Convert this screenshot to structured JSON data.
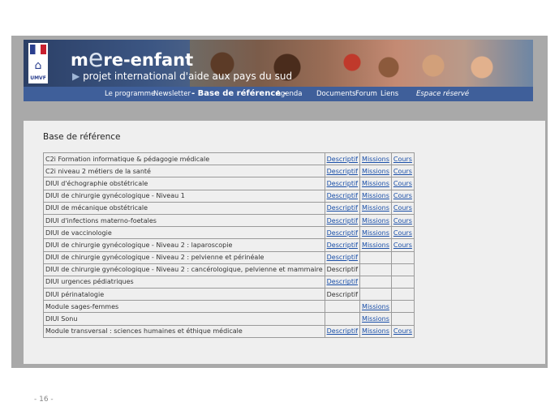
{
  "header": {
    "brand_prefix": "m",
    "brand_e": "e",
    "brand_suffix": "re-enfant",
    "tagline_arrow": "▶",
    "tagline": "projet international d'aide aux pays du sud",
    "logo_text": "UMVF"
  },
  "nav": {
    "items": [
      "Le programme",
      "Newsletter",
      "- Base de référence -",
      "Agenda",
      "Documents",
      "Forum",
      "Liens",
      "Espace réservé"
    ]
  },
  "content": {
    "title": "Base de référence",
    "rows": [
      {
        "name": "C2i Formation informatique & pédagogie médicale",
        "descriptif": "Descriptif",
        "descriptif_link": true,
        "missions": "Missions",
        "cours": "Cours"
      },
      {
        "name": "C2i niveau 2 métiers de la santé",
        "descriptif": "Descriptif",
        "descriptif_link": true,
        "missions": "Missions",
        "cours": "Cours"
      },
      {
        "name": "DIUI d'échographie obstétricale",
        "descriptif": "Descriptif",
        "descriptif_link": true,
        "missions": "Missions",
        "cours": "Cours"
      },
      {
        "name": "DIUI de chirurgie gynécologique - Niveau 1",
        "descriptif": "Descriptif",
        "descriptif_link": true,
        "missions": "Missions",
        "cours": "Cours"
      },
      {
        "name": "DIUI de mécanique obstétricale",
        "descriptif": "Descriptif",
        "descriptif_link": true,
        "missions": "Missions",
        "cours": "Cours"
      },
      {
        "name": "DIUI d'infections materno-foetales",
        "descriptif": "Descriptif",
        "descriptif_link": true,
        "missions": "Missions",
        "cours": "Cours"
      },
      {
        "name": "DIUI de vaccinologie",
        "descriptif": "Descriptif",
        "descriptif_link": true,
        "missions": "Missions",
        "cours": "Cours"
      },
      {
        "name": "DIUI de chirurgie gynécologique - Niveau 2 : laparoscopie",
        "descriptif": "Descriptif",
        "descriptif_link": true,
        "missions": "Missions",
        "cours": "Cours"
      },
      {
        "name": "DIUI de chirurgie gynécologique - Niveau 2 : pelvienne et périnéale",
        "descriptif": "Descriptif",
        "descriptif_link": true,
        "missions": "",
        "cours": ""
      },
      {
        "name": "DIUI de chirurgie gynécologique - Niveau 2 : cancérologique, pelvienne et mammaire",
        "descriptif": "Descriptif",
        "descriptif_link": false,
        "missions": "",
        "cours": ""
      },
      {
        "name": "DIUI urgences pédiatriques",
        "descriptif": "Descriptif",
        "descriptif_link": true,
        "missions": "",
        "cours": ""
      },
      {
        "name": "DIUI périnatalogie",
        "descriptif": "Descriptif",
        "descriptif_link": false,
        "missions": "",
        "cours": ""
      },
      {
        "name": "Module sages-femmes",
        "descriptif": "",
        "descriptif_link": false,
        "missions": "Missions",
        "cours": ""
      },
      {
        "name": "DIUI Sonu",
        "descriptif": "",
        "descriptif_link": false,
        "missions": "Missions",
        "cours": ""
      },
      {
        "name": "Module transversal : sciences humaines et éthique médicale",
        "descriptif": "Descriptif",
        "descriptif_link": true,
        "missions": "Missions",
        "cours": "Cours"
      }
    ]
  },
  "footer": {
    "page_number": "- 16 -"
  }
}
